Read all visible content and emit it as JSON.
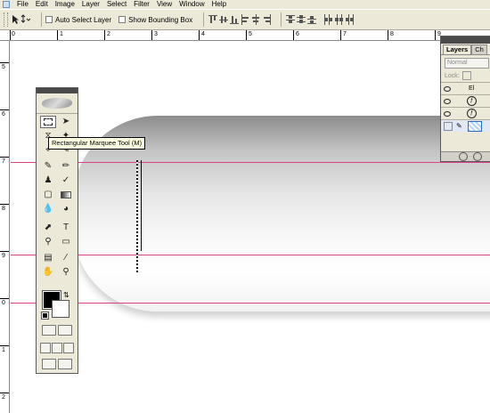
{
  "menubar": {
    "items": [
      "File",
      "Edit",
      "Image",
      "Layer",
      "Select",
      "Filter",
      "View",
      "Window",
      "Help"
    ]
  },
  "options_bar": {
    "auto_select_label": "Auto Select Layer",
    "show_bounding_box_label": "Show Bounding Box",
    "auto_select_checked": false,
    "show_bounding_box_checked": false
  },
  "rulers": {
    "top_labels": [
      "0",
      "1",
      "2",
      "3",
      "4",
      "5",
      "6",
      "7",
      "8",
      "9"
    ],
    "left_labels": [
      "5",
      "6",
      "7",
      "8",
      "9",
      "0",
      "1",
      "2"
    ]
  },
  "tooltip": {
    "text": "Rectangular Marquee Tool (M)"
  },
  "toolbox": {
    "foreground_color": "#000000",
    "background_color": "#ffffff"
  },
  "layers_panel": {
    "tab_layers": "Layers",
    "tab_channels": "Ch",
    "blend_mode": "Normal",
    "lock_label": "Lock:",
    "layer_label": "El",
    "fx_label": "ƒ"
  },
  "colors": {
    "guide": "#e0408a",
    "ui_gray": "#ece9d8"
  }
}
